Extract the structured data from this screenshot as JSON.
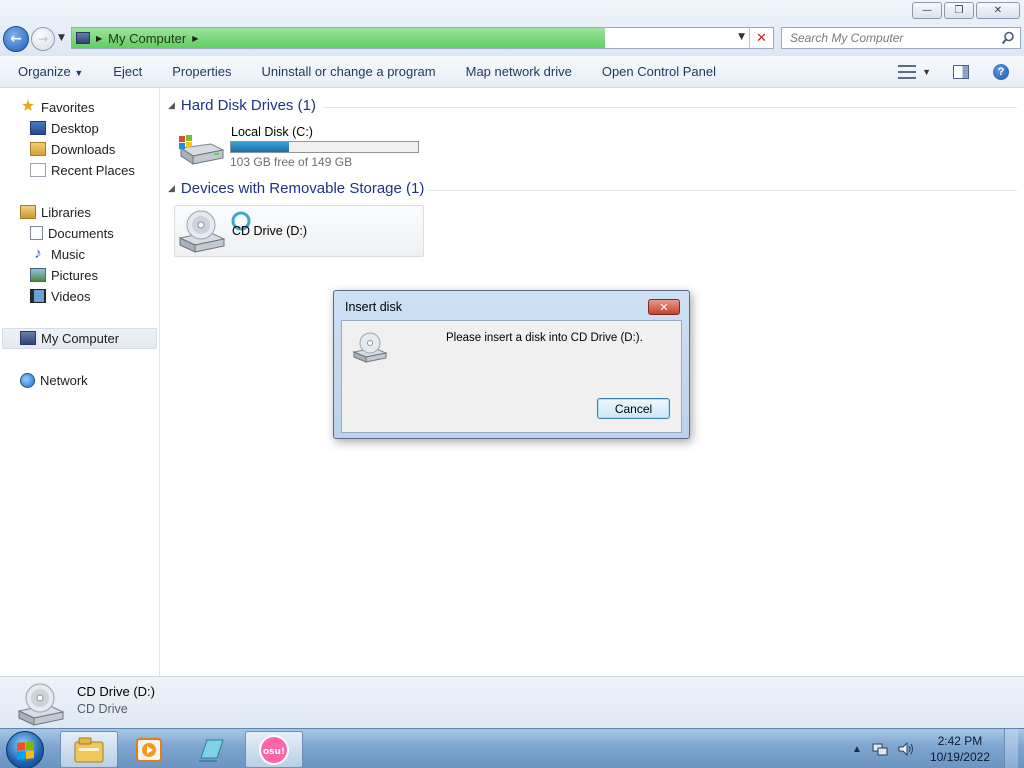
{
  "window": {
    "minimize_icon": "minimize-icon",
    "maximize_icon": "restore-icon",
    "close_icon": "close-icon"
  },
  "address_bar": {
    "location": "My Computer",
    "progress_percent": 76
  },
  "search": {
    "placeholder": "Search My Computer"
  },
  "toolbar": {
    "organize": "Organize",
    "eject": "Eject",
    "properties": "Properties",
    "uninstall": "Uninstall or change a program",
    "map_drive": "Map network drive",
    "control_panel": "Open Control Panel"
  },
  "nav_pane": {
    "favorites": "Favorites",
    "desktop": "Desktop",
    "downloads": "Downloads",
    "recent_places": "Recent Places",
    "libraries": "Libraries",
    "documents": "Documents",
    "music": "Music",
    "pictures": "Pictures",
    "videos": "Videos",
    "my_computer": "My Computer",
    "network": "Network"
  },
  "content": {
    "hdd_group": "Hard Disk Drives (1)",
    "local_disk_name": "Local Disk (C:)",
    "local_disk_free": "103 GB free of 149 GB",
    "local_disk_used_fraction": 0.31,
    "removable_group": "Devices with Removable Storage (1)",
    "cd_drive_name": "CD Drive (D:)"
  },
  "dialog": {
    "title": "Insert disk",
    "message": "Please insert a disk into CD Drive (D:).",
    "cancel": "Cancel"
  },
  "details": {
    "name": "CD Drive (D:)",
    "type": "CD Drive"
  },
  "taskbar": {
    "time": "2:42 PM",
    "date": "10/19/2022",
    "pinned_icons": [
      "explorer-icon",
      "media-player-icon",
      "notepad-icon",
      "osu-icon"
    ],
    "osu_label": "osu!"
  },
  "colors": {
    "accent_blue": "#1e3287",
    "progress_green": "#60cf60"
  }
}
